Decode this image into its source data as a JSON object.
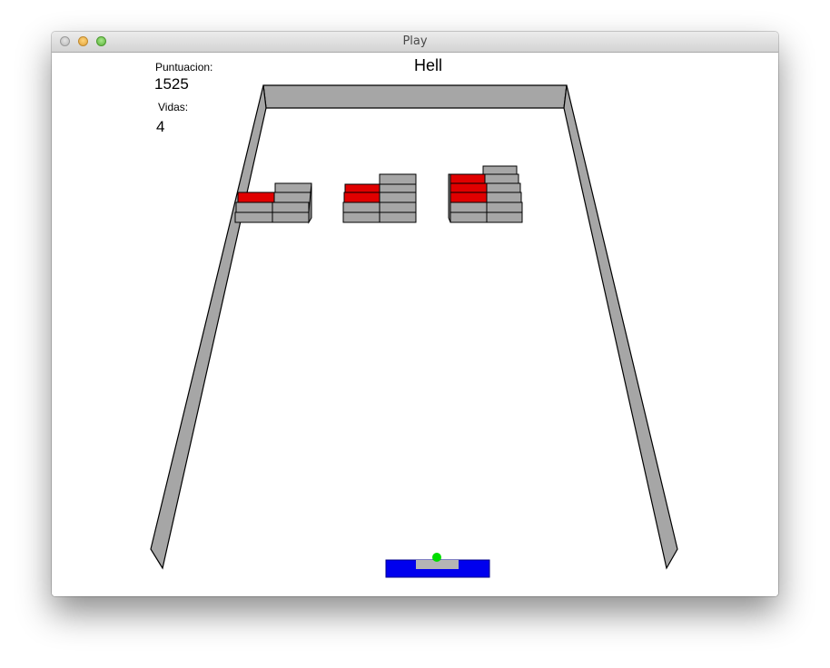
{
  "window": {
    "title": "Play"
  },
  "hud": {
    "score_label": "Puntuacion:",
    "score_value": "1525",
    "lives_label": "Vidas:",
    "lives_value": "4",
    "level_name": "Hell"
  },
  "colors": {
    "wall": "#a6a6a6",
    "brick_gray": "#a6a6a6",
    "brick_red": "#e00000",
    "paddle": "#0000ee",
    "paddle_top": "#b5b5b5",
    "ball": "#00dd00"
  }
}
